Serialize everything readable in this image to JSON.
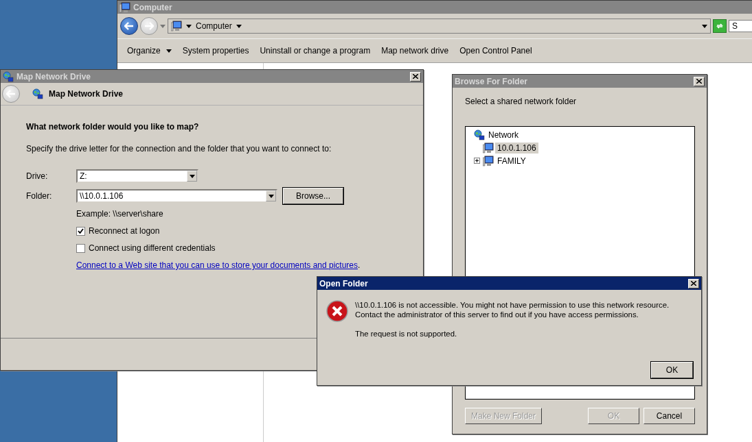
{
  "explorer": {
    "title": "Computer",
    "address": "Computer",
    "search_placeholder": "S",
    "toolbar": [
      {
        "label": "Organize",
        "dropdown": true
      },
      {
        "label": "System properties",
        "dropdown": false
      },
      {
        "label": "Uninstall or change a program",
        "dropdown": false
      },
      {
        "label": "Map network drive",
        "dropdown": false
      },
      {
        "label": "Open Control Panel",
        "dropdown": false
      }
    ]
  },
  "map_drive": {
    "title": "Map Network Drive",
    "header": "Map Network Drive",
    "heading": "What network folder would you like to map?",
    "instruction": "Specify the drive letter for the connection and the folder that you want to connect to:",
    "drive": {
      "label": "Drive:",
      "value": "Z:"
    },
    "folder": {
      "label": "Folder:",
      "value": "\\\\10.0.1.106"
    },
    "browse": "Browse...",
    "example": "Example: \\\\server\\share",
    "options": [
      {
        "label": "Reconnect at logon",
        "checked": true
      },
      {
        "label": "Connect using different credentials",
        "checked": false
      }
    ],
    "link": "Connect to a Web site that you can use to store your documents and pictures",
    "link_suffix": "."
  },
  "browse_folder": {
    "title": "Browse For Folder",
    "prompt": "Select a shared network folder",
    "tree": [
      {
        "label": "Network",
        "kind": "root",
        "selected": false,
        "children": [
          {
            "label": "10.0.1.106",
            "kind": "leaf",
            "selected": true
          },
          {
            "label": "FAMILY",
            "kind": "collapsed",
            "selected": false
          }
        ]
      }
    ],
    "buttons": [
      {
        "label": "Make New Folder",
        "disabled": true
      },
      {
        "label": "OK",
        "disabled": true
      },
      {
        "label": "Cancel",
        "disabled": false
      }
    ]
  },
  "error": {
    "title": "Open Folder",
    "message": "\\\\10.0.1.106 is not accessible. You might not have permission to use this network resource. Contact the administrator of this server to find out if you have access permissions.",
    "detail": "The request is not supported.",
    "button": "OK"
  }
}
